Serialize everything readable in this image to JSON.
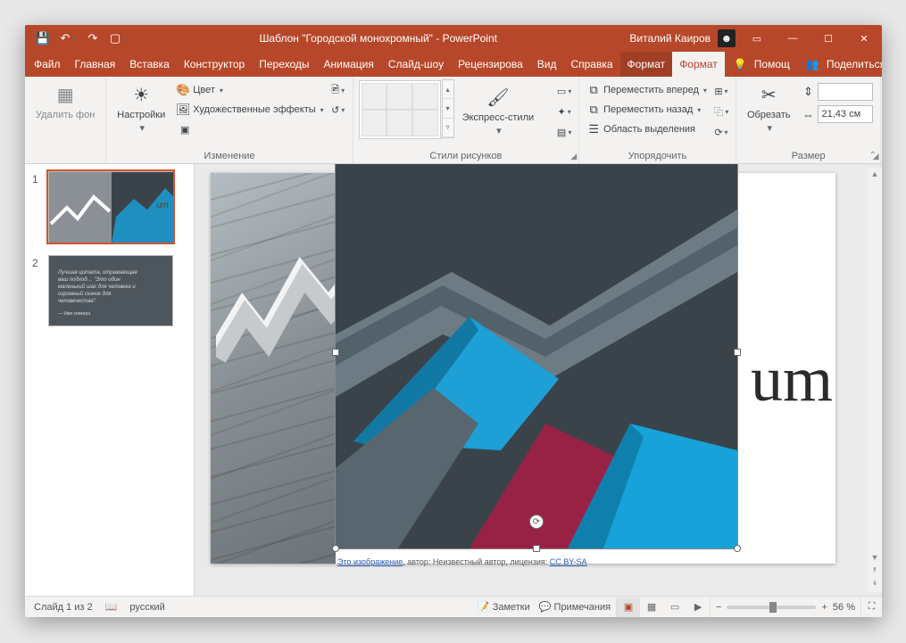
{
  "title": "Шаблон \"Городской монохромный\"  -  PowerPoint",
  "user": "Виталий Каиров",
  "tabs": {
    "file": "Файл",
    "home": "Главная",
    "insert": "Вставка",
    "design": "Конструктор",
    "transitions": "Переходы",
    "animations": "Анимация",
    "slideshow": "Слайд-шоу",
    "review": "Рецензирова",
    "view": "Вид",
    "help": "Справка",
    "format1": "Формат",
    "format2": "Формат",
    "tell": "Помощ",
    "share": "Поделиться"
  },
  "ribbon": {
    "removebg": "Удалить фон",
    "corrections": "Настройки",
    "color": "Цвет",
    "artistic": "Художественные эффекты",
    "group_adjust": "Изменение",
    "quickstyles": "Экспресс-стили",
    "group_styles": "Стили рисунков",
    "bring_forward": "Переместить вперед",
    "send_backward": "Переместить назад",
    "selection_pane": "Область выделения",
    "group_arrange": "Упорядочить",
    "crop": "Обрезать",
    "size_value": "21,43 см",
    "group_size": "Размер"
  },
  "status": {
    "slide": "Слайд 1 из 2",
    "lang": "русский",
    "notes": "Заметки",
    "comments": "Примечания",
    "zoom": "56 %"
  },
  "slide_text": "um",
  "caption": {
    "a1": "Это изображение",
    "mid": ", автор: Неизвестный автор, лицензия: ",
    "a2": "CC BY-SA"
  },
  "thumbs": {
    "n1": "1",
    "n2": "2"
  }
}
